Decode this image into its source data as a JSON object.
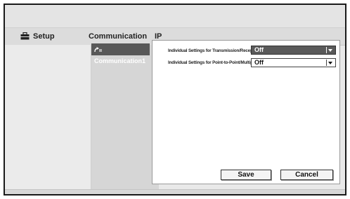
{
  "header": {
    "setup_label": "Setup",
    "tab_communication": "Communication",
    "tab_ip": "IP"
  },
  "subnav": {
    "item_label": "Communication1"
  },
  "settings": {
    "rows": [
      {
        "label": "Individual Settings for Transmission/Reception",
        "value": "Off"
      },
      {
        "label": "Individual Settings for Point-to-Point/Multipoint",
        "value": "Off"
      }
    ]
  },
  "actions": {
    "save_label": "Save",
    "cancel_label": "Cancel"
  },
  "icons": [
    "toolbox-icon",
    "communication-icon",
    "dropdown-arrow-icon"
  ]
}
